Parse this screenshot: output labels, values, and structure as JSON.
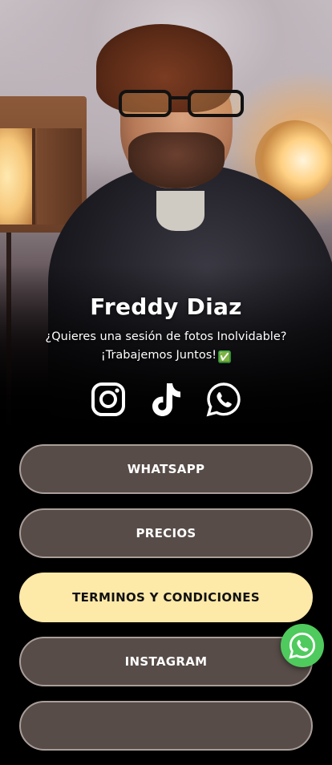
{
  "profile": {
    "name": "Freddy Diaz",
    "bio_line1": "¿Quieres una sesión de fotos Inolvidable?",
    "bio_line2": "¡Trabajemos Juntos!",
    "bio_emoji": "✅"
  },
  "socials": [
    {
      "icon": "instagram-icon"
    },
    {
      "icon": "tiktok-icon"
    },
    {
      "icon": "whatsapp-icon"
    }
  ],
  "links": [
    {
      "label": "WHATSAPP"
    },
    {
      "label": "PRECIOS"
    },
    {
      "label": "TERMINOS Y CONDICIONES"
    },
    {
      "label": "INSTAGRAM"
    },
    {
      "label": ""
    }
  ],
  "colors": {
    "background": "#000000",
    "button": "#574c48",
    "button_border": "#a99e98",
    "highlight_button": "#fde9a8",
    "whatsapp_green": "#4fca5d"
  },
  "fab": {
    "icon": "whatsapp-icon"
  }
}
